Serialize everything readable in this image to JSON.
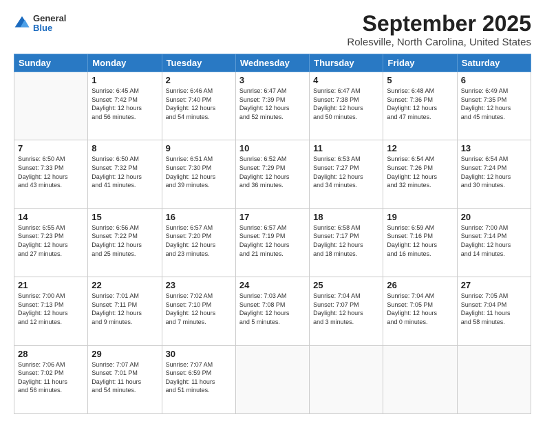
{
  "header": {
    "logo_general": "General",
    "logo_blue": "Blue",
    "title": "September 2025",
    "subtitle": "Rolesville, North Carolina, United States"
  },
  "days_of_week": [
    "Sunday",
    "Monday",
    "Tuesday",
    "Wednesday",
    "Thursday",
    "Friday",
    "Saturday"
  ],
  "weeks": [
    [
      {
        "day": "",
        "info": ""
      },
      {
        "day": "1",
        "info": "Sunrise: 6:45 AM\nSunset: 7:42 PM\nDaylight: 12 hours\nand 56 minutes."
      },
      {
        "day": "2",
        "info": "Sunrise: 6:46 AM\nSunset: 7:40 PM\nDaylight: 12 hours\nand 54 minutes."
      },
      {
        "day": "3",
        "info": "Sunrise: 6:47 AM\nSunset: 7:39 PM\nDaylight: 12 hours\nand 52 minutes."
      },
      {
        "day": "4",
        "info": "Sunrise: 6:47 AM\nSunset: 7:38 PM\nDaylight: 12 hours\nand 50 minutes."
      },
      {
        "day": "5",
        "info": "Sunrise: 6:48 AM\nSunset: 7:36 PM\nDaylight: 12 hours\nand 47 minutes."
      },
      {
        "day": "6",
        "info": "Sunrise: 6:49 AM\nSunset: 7:35 PM\nDaylight: 12 hours\nand 45 minutes."
      }
    ],
    [
      {
        "day": "7",
        "info": "Sunrise: 6:50 AM\nSunset: 7:33 PM\nDaylight: 12 hours\nand 43 minutes."
      },
      {
        "day": "8",
        "info": "Sunrise: 6:50 AM\nSunset: 7:32 PM\nDaylight: 12 hours\nand 41 minutes."
      },
      {
        "day": "9",
        "info": "Sunrise: 6:51 AM\nSunset: 7:30 PM\nDaylight: 12 hours\nand 39 minutes."
      },
      {
        "day": "10",
        "info": "Sunrise: 6:52 AM\nSunset: 7:29 PM\nDaylight: 12 hours\nand 36 minutes."
      },
      {
        "day": "11",
        "info": "Sunrise: 6:53 AM\nSunset: 7:27 PM\nDaylight: 12 hours\nand 34 minutes."
      },
      {
        "day": "12",
        "info": "Sunrise: 6:54 AM\nSunset: 7:26 PM\nDaylight: 12 hours\nand 32 minutes."
      },
      {
        "day": "13",
        "info": "Sunrise: 6:54 AM\nSunset: 7:24 PM\nDaylight: 12 hours\nand 30 minutes."
      }
    ],
    [
      {
        "day": "14",
        "info": "Sunrise: 6:55 AM\nSunset: 7:23 PM\nDaylight: 12 hours\nand 27 minutes."
      },
      {
        "day": "15",
        "info": "Sunrise: 6:56 AM\nSunset: 7:22 PM\nDaylight: 12 hours\nand 25 minutes."
      },
      {
        "day": "16",
        "info": "Sunrise: 6:57 AM\nSunset: 7:20 PM\nDaylight: 12 hours\nand 23 minutes."
      },
      {
        "day": "17",
        "info": "Sunrise: 6:57 AM\nSunset: 7:19 PM\nDaylight: 12 hours\nand 21 minutes."
      },
      {
        "day": "18",
        "info": "Sunrise: 6:58 AM\nSunset: 7:17 PM\nDaylight: 12 hours\nand 18 minutes."
      },
      {
        "day": "19",
        "info": "Sunrise: 6:59 AM\nSunset: 7:16 PM\nDaylight: 12 hours\nand 16 minutes."
      },
      {
        "day": "20",
        "info": "Sunrise: 7:00 AM\nSunset: 7:14 PM\nDaylight: 12 hours\nand 14 minutes."
      }
    ],
    [
      {
        "day": "21",
        "info": "Sunrise: 7:00 AM\nSunset: 7:13 PM\nDaylight: 12 hours\nand 12 minutes."
      },
      {
        "day": "22",
        "info": "Sunrise: 7:01 AM\nSunset: 7:11 PM\nDaylight: 12 hours\nand 9 minutes."
      },
      {
        "day": "23",
        "info": "Sunrise: 7:02 AM\nSunset: 7:10 PM\nDaylight: 12 hours\nand 7 minutes."
      },
      {
        "day": "24",
        "info": "Sunrise: 7:03 AM\nSunset: 7:08 PM\nDaylight: 12 hours\nand 5 minutes."
      },
      {
        "day": "25",
        "info": "Sunrise: 7:04 AM\nSunset: 7:07 PM\nDaylight: 12 hours\nand 3 minutes."
      },
      {
        "day": "26",
        "info": "Sunrise: 7:04 AM\nSunset: 7:05 PM\nDaylight: 12 hours\nand 0 minutes."
      },
      {
        "day": "27",
        "info": "Sunrise: 7:05 AM\nSunset: 7:04 PM\nDaylight: 11 hours\nand 58 minutes."
      }
    ],
    [
      {
        "day": "28",
        "info": "Sunrise: 7:06 AM\nSunset: 7:02 PM\nDaylight: 11 hours\nand 56 minutes."
      },
      {
        "day": "29",
        "info": "Sunrise: 7:07 AM\nSunset: 7:01 PM\nDaylight: 11 hours\nand 54 minutes."
      },
      {
        "day": "30",
        "info": "Sunrise: 7:07 AM\nSunset: 6:59 PM\nDaylight: 11 hours\nand 51 minutes."
      },
      {
        "day": "",
        "info": ""
      },
      {
        "day": "",
        "info": ""
      },
      {
        "day": "",
        "info": ""
      },
      {
        "day": "",
        "info": ""
      }
    ]
  ]
}
